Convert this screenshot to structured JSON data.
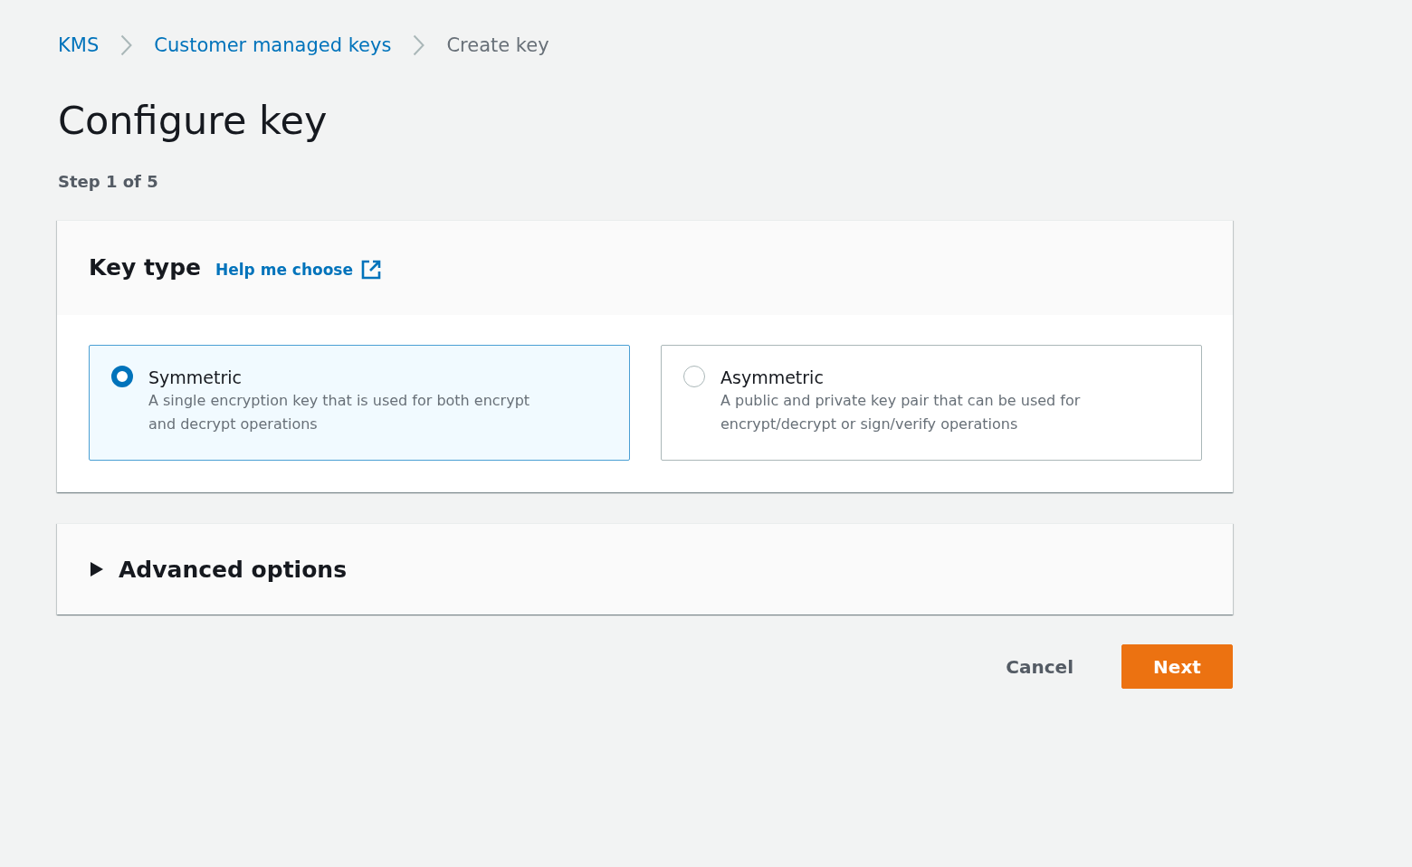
{
  "breadcrumbs": [
    {
      "label": "KMS",
      "kind": "link"
    },
    {
      "label": "Customer managed keys",
      "kind": "link"
    },
    {
      "label": "Create key",
      "kind": "current"
    }
  ],
  "title": "Configure key",
  "step": "Step 1 of 5",
  "key_type": {
    "heading": "Key type",
    "help_link": "Help me choose",
    "options": [
      {
        "label": "Symmetric",
        "description": "A single encryption key that is used for both encrypt and decrypt operations",
        "selected": true
      },
      {
        "label": "Asymmetric",
        "description": "A public and private key pair that can be used for encrypt/decrypt or sign/verify operations",
        "selected": false
      }
    ]
  },
  "advanced_options": {
    "label": "Advanced options",
    "expanded": false
  },
  "buttons": [
    {
      "label": "Cancel",
      "kind": "link"
    },
    {
      "label": "Next",
      "kind": "primary"
    }
  ]
}
